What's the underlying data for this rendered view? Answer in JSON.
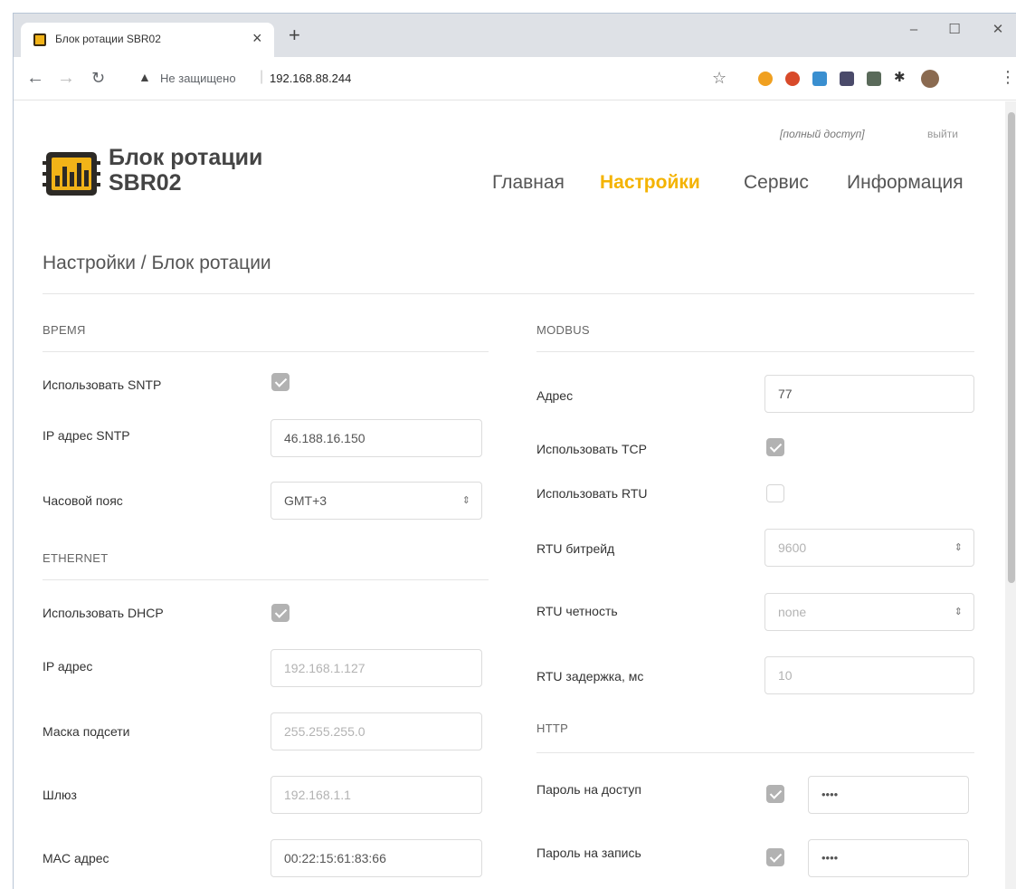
{
  "browser": {
    "tab_title": "Блок ротации SBR02",
    "tab_close": "×",
    "new_tab": "+",
    "not_secure": "Не защищено",
    "url": "192.168.88.244",
    "window_controls": {
      "minimize": "–",
      "maximize": "☐",
      "close": "✕"
    }
  },
  "header": {
    "access": "[полный доступ]",
    "logout": "выйти",
    "logo_line1": "Блок ротации",
    "logo_line2": "SBR02",
    "nav": [
      "Главная",
      "Настройки",
      "Сервис",
      "Информация"
    ],
    "active_nav": "Настройки",
    "accent_color": "#f4b300"
  },
  "breadcrumb": "Настройки / Блок ротации",
  "time": {
    "title": "Время",
    "use_sntp_label": "Использовать SNTP",
    "use_sntp": true,
    "sntp_ip_label": "IP адрес SNTP",
    "sntp_ip": "46.188.16.150",
    "timezone_label": "Часовой пояс",
    "timezone": "GMT+3"
  },
  "ethernet": {
    "title": "Ethernet",
    "use_dhcp_label": "Использовать DHCP",
    "use_dhcp": true,
    "ip_label": "IP адрес",
    "ip": "192.168.1.127",
    "mask_label": "Маска подсети",
    "mask": "255.255.255.0",
    "gateway_label": "Шлюз",
    "gateway": "192.168.1.1",
    "mac_label": "MAC адрес",
    "mac": "00:22:15:61:83:66"
  },
  "modbus": {
    "title": "Modbus",
    "address_label": "Адрес",
    "address": "77",
    "use_tcp_label": "Использовать TCP",
    "use_tcp": true,
    "use_rtu_label": "Использовать RTU",
    "use_rtu": false,
    "rtu_baud_label": "RTU битрейд",
    "rtu_baud": "9600",
    "rtu_parity_label": "RTU четность",
    "rtu_parity": "none",
    "rtu_delay_label": "RTU задержка, мс",
    "rtu_delay": "10"
  },
  "http": {
    "title": "HTTP",
    "access_pwd_label": "Пароль на доступ",
    "access_pwd_enabled": true,
    "access_pwd": "••••",
    "write_pwd_label": "Пароль на запись",
    "write_pwd_enabled": true,
    "write_pwd": "••••"
  },
  "icons": {
    "select_arrow": "⇕"
  }
}
